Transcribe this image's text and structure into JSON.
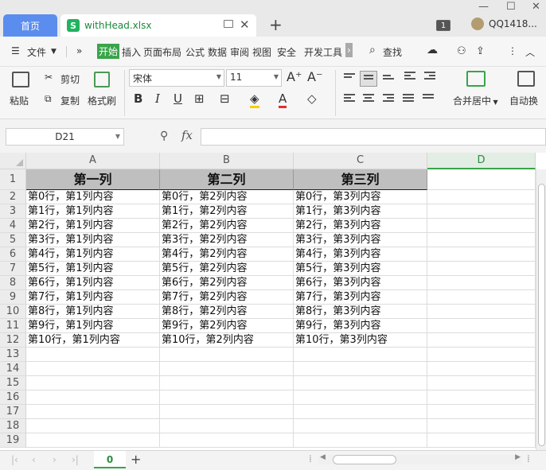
{
  "titlebar": {
    "home_tab": "首页",
    "file_tab": "withHead.xlsx",
    "file_icon_letter": "S",
    "badge": "1",
    "user": "QQ1418..."
  },
  "menubar": {
    "file_label": "文件",
    "tabs": [
      "开始",
      "插入",
      "页面布局",
      "公式",
      "数据",
      "审阅",
      "视图",
      "安全",
      "开发工具"
    ],
    "search_label": "查找"
  },
  "ribbon": {
    "paste": "粘贴",
    "cut": "剪切",
    "copy": "复制",
    "format_painter": "格式刷",
    "font_name": "宋体",
    "font_size": "11",
    "bold": "B",
    "italic": "I",
    "underline": "U",
    "merge_center": "合并居中",
    "auto_wrap": "自动换"
  },
  "formula_bar": {
    "cell_ref": "D21",
    "fx_label": "fx",
    "formula": ""
  },
  "sheet": {
    "columns": [
      "A",
      "B",
      "C",
      "D"
    ],
    "selected_column": "D",
    "rows": [
      "1",
      "2",
      "3",
      "4",
      "5",
      "6",
      "7",
      "8",
      "9",
      "10",
      "11",
      "12",
      "13",
      "14",
      "15",
      "16",
      "17",
      "18",
      "19"
    ],
    "header_row": [
      "第一列",
      "第二列",
      "第三列"
    ],
    "data_rows": [
      [
        "第0行，第1列内容",
        "第0行，第2列内容",
        "第0行，第3列内容"
      ],
      [
        "第1行，第1列内容",
        "第1行，第2列内容",
        "第1行，第3列内容"
      ],
      [
        "第2行，第1列内容",
        "第2行，第2列内容",
        "第2行，第3列内容"
      ],
      [
        "第3行，第1列内容",
        "第3行，第2列内容",
        "第3行，第3列内容"
      ],
      [
        "第4行，第1列内容",
        "第4行，第2列内容",
        "第4行，第3列内容"
      ],
      [
        "第5行，第1列内容",
        "第5行，第2列内容",
        "第5行，第3列内容"
      ],
      [
        "第6行，第1列内容",
        "第6行，第2列内容",
        "第6行，第3列内容"
      ],
      [
        "第7行，第1列内容",
        "第7行，第2列内容",
        "第7行，第3列内容"
      ],
      [
        "第8行，第1列内容",
        "第8行，第2列内容",
        "第8行，第3列内容"
      ],
      [
        "第9行，第1列内容",
        "第9行，第2列内容",
        "第9行，第3列内容"
      ],
      [
        "第10行，第1列内容",
        "第10行，第2列内容",
        "第10行，第3列内容"
      ]
    ]
  },
  "bottombar": {
    "sheet_tab": "0",
    "add_sheet": "+"
  },
  "colors": {
    "accent_green": "#3aa44a",
    "home_tab_blue": "#5b8def",
    "header_fill": "#bfbfbf"
  }
}
